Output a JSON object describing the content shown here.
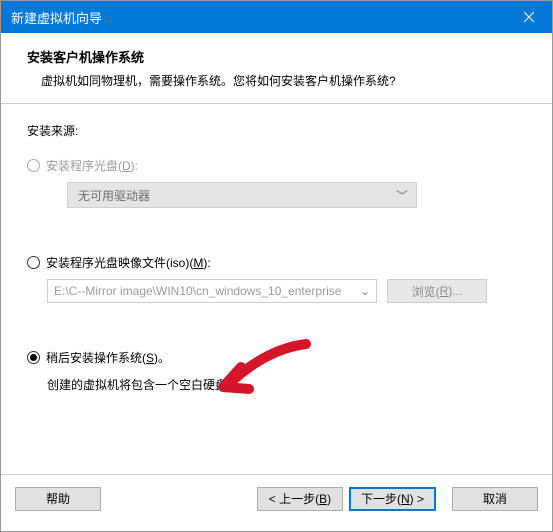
{
  "titlebar": {
    "title": "新建虚拟机向导"
  },
  "header": {
    "title": "安装客户机操作系统",
    "subtitle": "虚拟机如同物理机，需要操作系统。您将如何安装客户机操作系统?"
  },
  "content": {
    "source_label": "安装来源:",
    "opt_disc": {
      "label_pre": "安装程序光盘(",
      "key": "D",
      "label_post": "):",
      "dropdown_text": "无可用驱动器"
    },
    "opt_iso": {
      "label_pre": "安装程序光盘映像文件(iso)(",
      "key": "M",
      "label_post": "):",
      "path": "E:\\C--Mirror image\\WIN10\\cn_windows_10_enterprise",
      "browse_pre": "浏览(",
      "browse_key": "R",
      "browse_post": ")..."
    },
    "opt_later": {
      "label_pre": "稍后安装操作系统(",
      "key": "S",
      "label_post": ")。",
      "hint": "创建的虚拟机将包含一个空白硬盘。"
    }
  },
  "footer": {
    "help": "帮助",
    "back_pre": "< 上一步(",
    "back_key": "B",
    "back_post": ")",
    "next_pre": "下一步(",
    "next_key": "N",
    "next_post": ") >",
    "cancel": "取消"
  }
}
